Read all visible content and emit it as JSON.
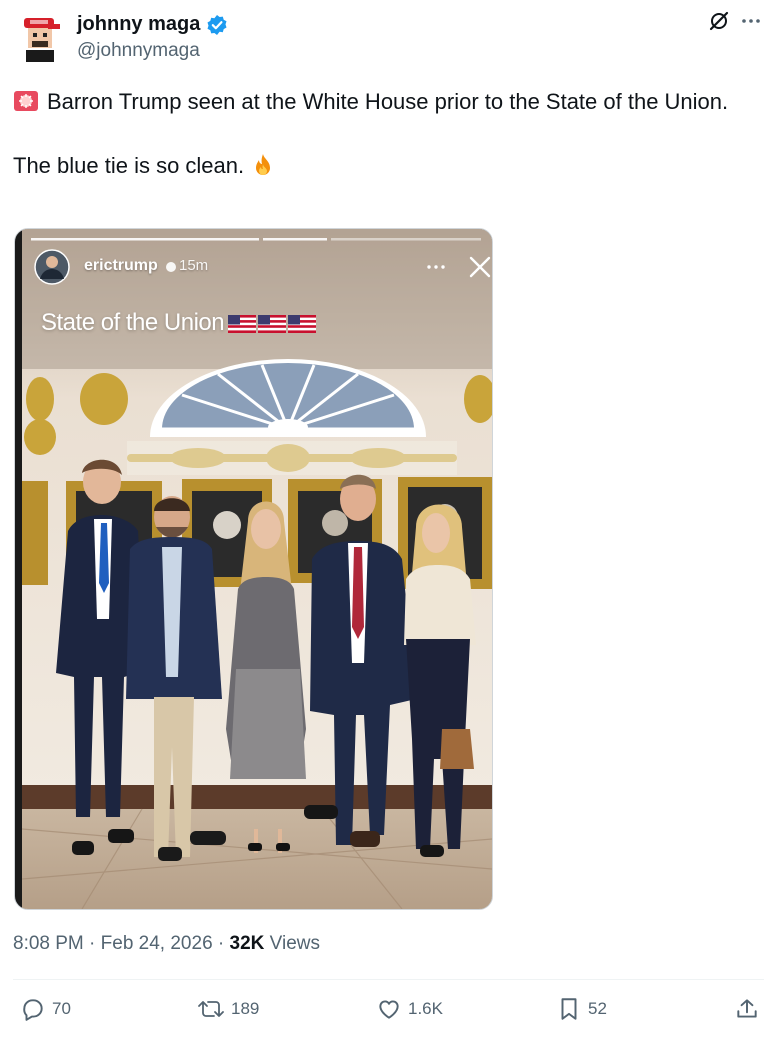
{
  "author": {
    "display_name": "johnny maga",
    "handle": "@johnnymaga",
    "verified": true,
    "verified_color": "#1d9bf0"
  },
  "post": {
    "line1": "Barron Trump seen at the White House prior to the State of the Union.",
    "line2": "The blue tie is so clean.",
    "emoji_start": "siren",
    "emoji_end": "fire"
  },
  "media": {
    "story_user": "erictrump",
    "story_time": "15m",
    "story_title": "State of the Union",
    "flags": [
      "us-flag",
      "us-flag",
      "us-flag"
    ]
  },
  "meta": {
    "time": "8:08 PM",
    "date": "Feb 24, 2026",
    "views_count": "32K",
    "views_label": "Views"
  },
  "actions": {
    "replies": "70",
    "reposts": "189",
    "likes": "1.6K",
    "bookmarks": "52"
  }
}
